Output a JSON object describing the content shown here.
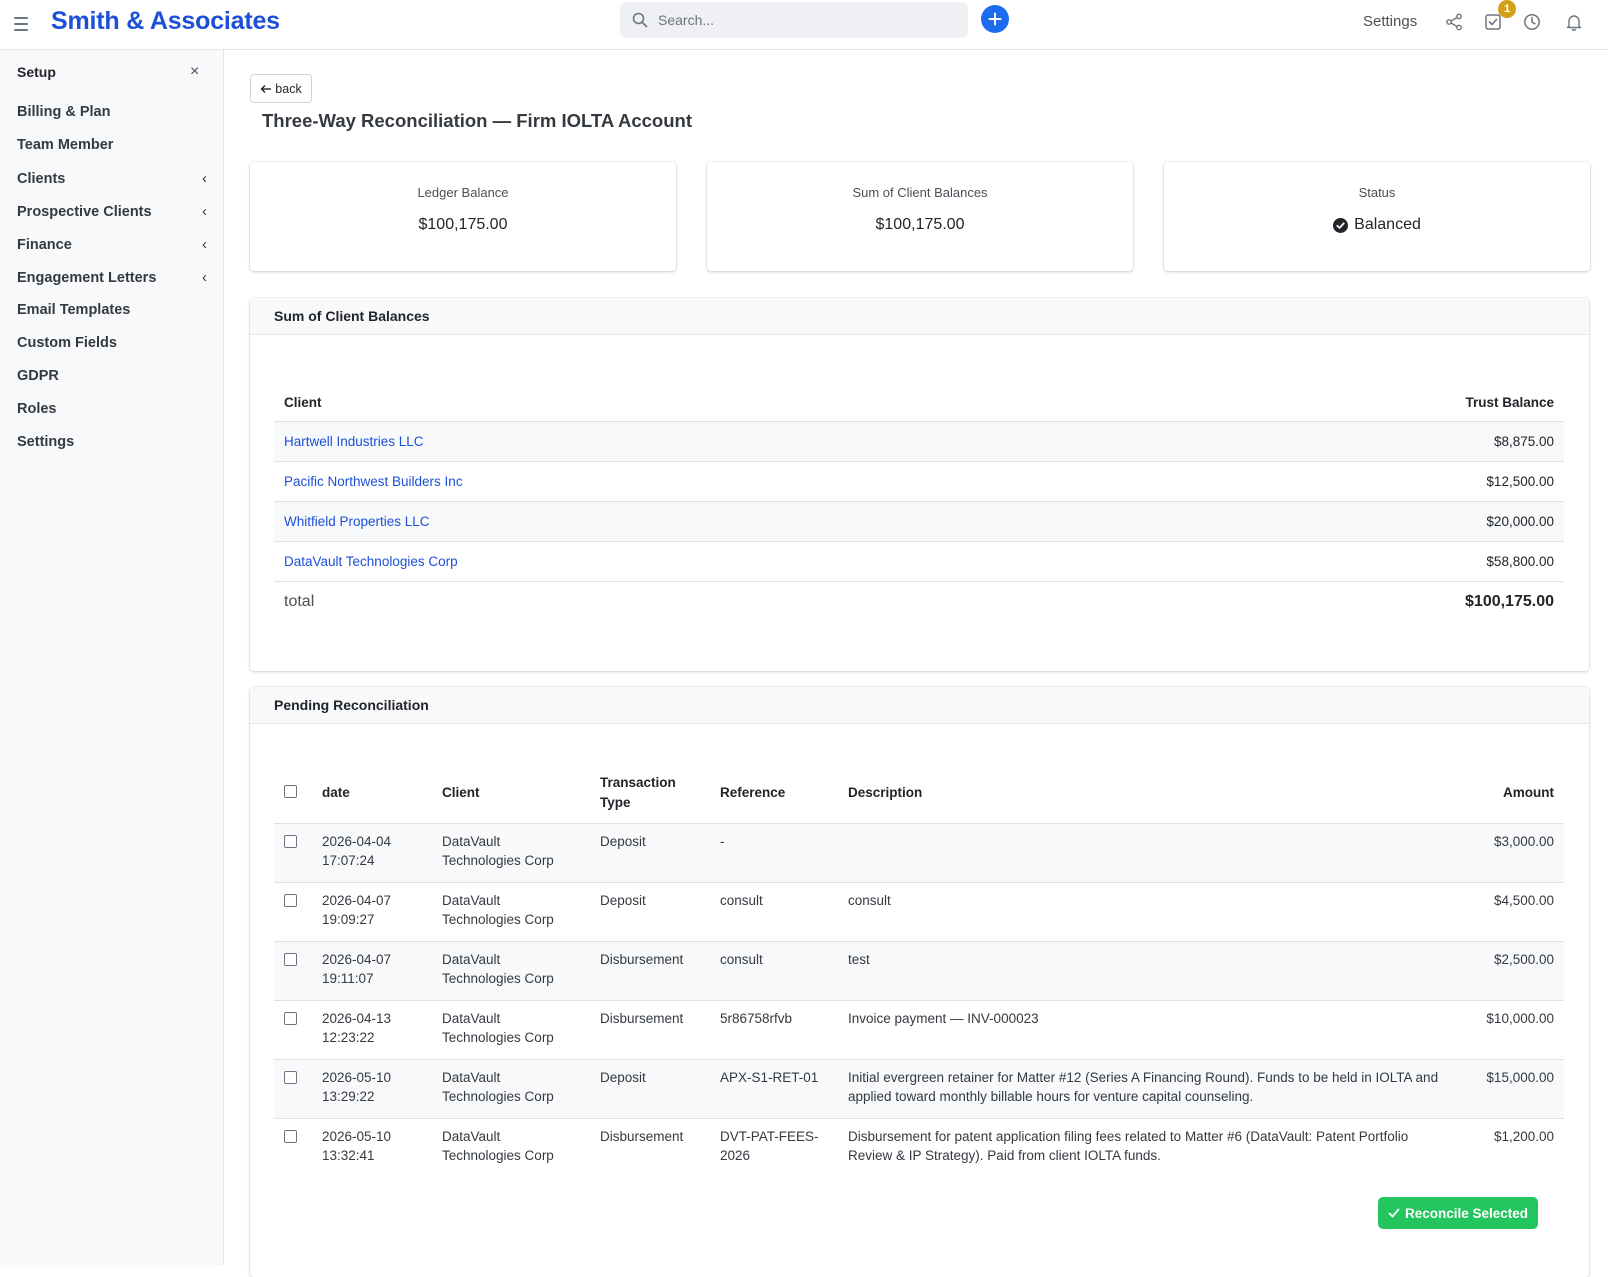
{
  "header": {
    "brand": "Smith & Associates",
    "search_placeholder": "Search...",
    "settings_label": "Settings",
    "tasks_badge": "1"
  },
  "sidebar": {
    "title": "Setup",
    "close": "×",
    "items": [
      {
        "label": "Billing & Plan",
        "chevron": ""
      },
      {
        "label": "Team Member",
        "chevron": ""
      },
      {
        "label": "Clients",
        "chevron": "‹"
      },
      {
        "label": "Prospective Clients",
        "chevron": "‹"
      },
      {
        "label": "Finance",
        "chevron": "‹"
      },
      {
        "label": "Engagement Letters",
        "chevron": "‹"
      },
      {
        "label": "Email Templates",
        "chevron": ""
      },
      {
        "label": "Custom Fields",
        "chevron": ""
      },
      {
        "label": "GDPR",
        "chevron": ""
      },
      {
        "label": "Roles",
        "chevron": ""
      },
      {
        "label": "Settings",
        "chevron": ""
      }
    ]
  },
  "page": {
    "back_label": "back",
    "title": "Three-Way Reconciliation — Firm IOLTA Account"
  },
  "stats": {
    "ledger": {
      "label": "Ledger Balance",
      "value": "$100,175.00"
    },
    "client_sum": {
      "label": "Sum of Client Balances",
      "value": "$100,175.00"
    },
    "status": {
      "label": "Status",
      "value": "Balanced"
    }
  },
  "balances": {
    "title": "Sum of Client Balances",
    "columns": {
      "client": "Client",
      "trust": "Trust Balance"
    },
    "rows": [
      {
        "client": "Hartwell Industries LLC",
        "amount": "$8,875.00"
      },
      {
        "client": "Pacific Northwest Builders Inc",
        "amount": "$12,500.00"
      },
      {
        "client": "Whitfield Properties LLC",
        "amount": "$20,000.00"
      },
      {
        "client": "DataVault Technologies Corp",
        "amount": "$58,800.00"
      }
    ],
    "total_label": "total",
    "total_value": "$100,175.00"
  },
  "pending": {
    "title": "Pending Reconciliation",
    "columns": {
      "date": "date",
      "client": "Client",
      "type": "Transaction Type",
      "reference": "Reference",
      "description": "Description",
      "amount": "Amount"
    },
    "rows": [
      {
        "date": "2026-04-04",
        "time": "17:07:24",
        "client1": "DataVault",
        "client2": "Technologies Corp",
        "type": "Deposit",
        "reference": "-",
        "description": "",
        "amount": "$3,000.00"
      },
      {
        "date": "2026-04-07",
        "time": "19:09:27",
        "client1": "DataVault",
        "client2": "Technologies Corp",
        "type": "Deposit",
        "reference": "consult",
        "description": "consult",
        "amount": "$4,500.00"
      },
      {
        "date": "2026-04-07",
        "time": "19:11:07",
        "client1": "DataVault",
        "client2": "Technologies Corp",
        "type": "Disbursement",
        "reference": "consult",
        "description": "test",
        "amount": "$2,500.00"
      },
      {
        "date": "2026-04-13",
        "time": "12:23:22",
        "client1": "DataVault",
        "client2": "Technologies Corp",
        "type": "Disbursement",
        "reference": "5r86758rfvb",
        "description": "Invoice payment — INV-000023",
        "amount": "$10,000.00"
      },
      {
        "date": "2026-05-10",
        "time": "13:29:22",
        "client1": "DataVault",
        "client2": "Technologies Corp",
        "type": "Deposit",
        "reference": "APX-S1-RET-01",
        "description": "Initial evergreen retainer for Matter #12 (Series A Financing Round). Funds to be held in IOLTA and applied toward monthly billable hours for venture capital counseling.",
        "amount": "$15,000.00"
      },
      {
        "date": "2026-05-10",
        "time": "13:32:41",
        "client1": "DataVault",
        "client2": "Technologies Corp",
        "type": "Disbursement",
        "reference": "DVT-PAT-FEES-2026",
        "description": "Disbursement for patent application filing fees related to Matter #6 (DataVault: Patent Portfolio Review & IP Strategy). Paid from client IOLTA funds.",
        "amount": "$1,200.00"
      }
    ],
    "reconcile_label": "Reconcile Selected"
  },
  "colors": {
    "brand": "#1d4fd8",
    "accent": "#1d6cf0",
    "deposit": "#16a34a",
    "disbursement": "#dc2626",
    "success": "#22c55e",
    "badge": "#d4a017"
  },
  "icons": [
    "menu-icon",
    "search-icon",
    "plus-icon",
    "share-icon",
    "tasks-icon",
    "clock-icon",
    "bell-icon",
    "arrow-left-icon",
    "check-circle-icon",
    "check-icon"
  ]
}
